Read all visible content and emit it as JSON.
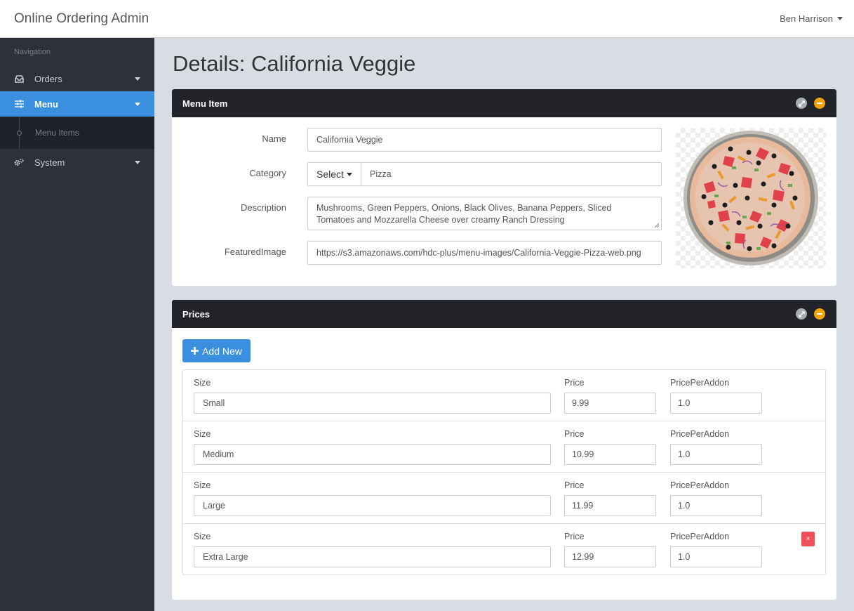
{
  "app": {
    "title": "Online Ordering Admin",
    "user_name": "Ben Harrison"
  },
  "sidebar": {
    "heading": "Navigation",
    "items": [
      {
        "label": "Orders",
        "icon": "inbox-icon"
      },
      {
        "label": "Menu",
        "icon": "sliders-icon",
        "active": true
      },
      {
        "label": "System",
        "icon": "gears-icon"
      }
    ],
    "sub_items": [
      {
        "label": "Menu Items"
      }
    ]
  },
  "page": {
    "title": "Details: California Veggie"
  },
  "menu_item_panel": {
    "title": "Menu Item",
    "labels": {
      "name": "Name",
      "category": "Category",
      "description": "Description",
      "featured_image": "FeaturedImage"
    },
    "values": {
      "name": "California Veggie",
      "category_select_label": "Select",
      "category": "Pizza",
      "description": "Mushrooms, Green Peppers, Onions, Black Olives, Banana Peppers, Sliced Tomatoes and Mozzarella Cheese over creamy Ranch Dressing",
      "featured_image": "https://s3.amazonaws.com/hdc-plus/menu-images/California-Veggie-Pizza-web.png"
    }
  },
  "prices_panel": {
    "title": "Prices",
    "add_label": "Add New",
    "column_labels": {
      "size": "Size",
      "price": "Price",
      "price_per_addon": "PricePerAddon"
    },
    "rows": [
      {
        "size": "Small",
        "price": "9.99",
        "price_per_addon": "1.0"
      },
      {
        "size": "Medium",
        "price": "10.99",
        "price_per_addon": "1.0"
      },
      {
        "size": "Large",
        "price": "11.99",
        "price_per_addon": "1.0"
      },
      {
        "size": "Extra Large",
        "price": "12.99",
        "price_per_addon": "1.0"
      }
    ],
    "remove_symbol": "×"
  },
  "colors": {
    "accent": "#3a8fdf",
    "sidebar": "#2d3139",
    "panel_header": "#222429",
    "collapse": "#f0a30a",
    "danger": "#f0505a"
  }
}
